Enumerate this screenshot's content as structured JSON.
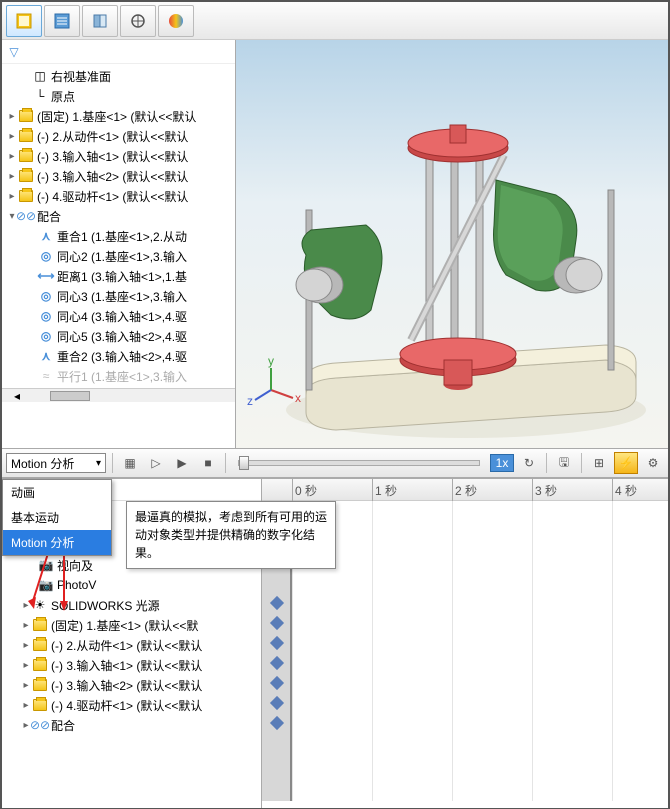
{
  "toolbar": {
    "tabs": [
      "assembly",
      "properties",
      "config",
      "display",
      "appearance"
    ]
  },
  "feature_tree": {
    "plane": "右视基准面",
    "origin": "原点",
    "parts": [
      "(固定) 1.基座<1> (默认<<默认",
      "(-) 2.从动件<1> (默认<<默认",
      "(-) 3.输入轴<1> (默认<<默认",
      "(-) 3.输入轴<2> (默认<<默认",
      "(-) 4.驱动杆<1> (默认<<默认"
    ],
    "mates_label": "配合",
    "mates": [
      {
        "t": "coinc",
        "txt": "重合1 (1.基座<1>,2.从动"
      },
      {
        "t": "conc",
        "txt": "同心2 (1.基座<1>,3.输入"
      },
      {
        "t": "dist",
        "txt": "距离1 (3.输入轴<1>,1.基"
      },
      {
        "t": "conc",
        "txt": "同心3 (1.基座<1>,3.输入"
      },
      {
        "t": "conc",
        "txt": "同心4 (3.输入轴<1>,4.驱"
      },
      {
        "t": "conc",
        "txt": "同心5 (3.输入轴<2>,4.驱"
      },
      {
        "t": "coinc",
        "txt": "重合2 (3.输入轴<2>,4.驱"
      },
      {
        "t": "par",
        "txt": "平行1 (1.基座<1>,3.输入"
      }
    ]
  },
  "motion": {
    "study_label": "Motion 分析",
    "speed": "1x",
    "dropdown": [
      "动画",
      "基本运动",
      "Motion 分析"
    ],
    "selected_index": 2,
    "tooltip": "最逼真的模拟，考虑到所有可用的运动对象类型并提供精确的数字化结果。"
  },
  "bottom_tree": {
    "hidden1": "视向及",
    "photoview": "PhotoV",
    "lights": "SOLIDWORKS 光源",
    "parts": [
      "(固定) 1.基座<1> (默认<<默",
      "(-) 2.从动件<1> (默认<<默认",
      "(-) 3.输入轴<1> (默认<<默认",
      "(-) 3.输入轴<2> (默认<<默认",
      "(-) 4.驱动杆<1> (默认<<默认"
    ],
    "mates_label": "配合"
  },
  "timeline": {
    "ticks": [
      "0 秒",
      "1 秒",
      "2 秒",
      "3 秒",
      "4 秒"
    ]
  }
}
